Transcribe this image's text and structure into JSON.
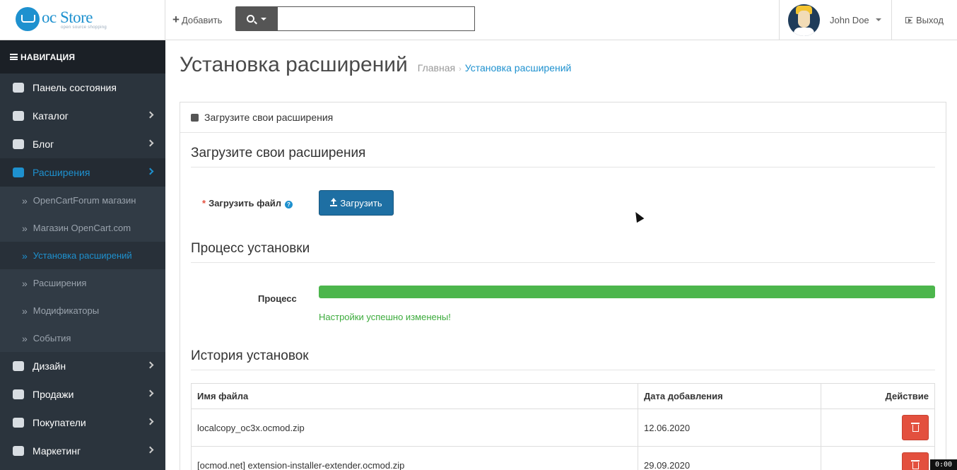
{
  "header": {
    "logo_text": "oc Store",
    "logo_tagline": "open source shopping",
    "add_label": "Добавить",
    "search_placeholder": "",
    "user_name": "John Doe",
    "logout_label": "Выход"
  },
  "sidebar": {
    "heading": "НАВИГАЦИЯ",
    "items": [
      {
        "label": "Панель состояния",
        "icon": "dashboard-icon",
        "has_children": false
      },
      {
        "label": "Каталог",
        "icon": "tags-icon",
        "has_children": true
      },
      {
        "label": "Блог",
        "icon": "book-icon",
        "has_children": true
      },
      {
        "label": "Расширения",
        "icon": "puzzle-icon",
        "has_children": true,
        "active": true
      },
      {
        "label": "Дизайн",
        "icon": "desktop-icon",
        "has_children": true
      },
      {
        "label": "Продажи",
        "icon": "cart-icon",
        "has_children": true
      },
      {
        "label": "Покупатели",
        "icon": "user-icon",
        "has_children": true
      },
      {
        "label": "Маркетинг",
        "icon": "share-icon",
        "has_children": true
      }
    ],
    "subitems": [
      {
        "label": "OpenCartForum магазин"
      },
      {
        "label": "Магазин OpenCart.com"
      },
      {
        "label": "Установка расширений",
        "active": true
      },
      {
        "label": "Расширения"
      },
      {
        "label": "Модификаторы"
      },
      {
        "label": "События"
      }
    ]
  },
  "page": {
    "title": "Установка расширений",
    "breadcrumb": {
      "home": "Главная",
      "current": "Установка расширений"
    }
  },
  "panel": {
    "heading": "Загрузите свои расширения",
    "upload_legend": "Загрузите свои расширения",
    "upload_label": "Загрузить файл",
    "upload_button": "Загрузить",
    "process_legend": "Процесс установки",
    "progress_label": "Процесс",
    "progress_percent": 100,
    "progress_message": "Настройки успешно изменены!",
    "history_legend": "История установок"
  },
  "history": {
    "columns": [
      "Имя файла",
      "Дата добавления",
      "Действие"
    ],
    "rows": [
      {
        "filename": "localcopy_oc3x.ocmod.zip",
        "date": "12.06.2020"
      },
      {
        "filename": "[ocmod.net] extension-installer-extender.ocmod.zip",
        "date": "29.09.2020"
      }
    ]
  },
  "overlay": {
    "timer": "0:00"
  },
  "colors": {
    "accent": "#1e91cf",
    "sidebar_bg": "#2b343d",
    "danger": "#e3503e",
    "success": "#4cb64c",
    "primary_button": "#1e6fa3"
  }
}
